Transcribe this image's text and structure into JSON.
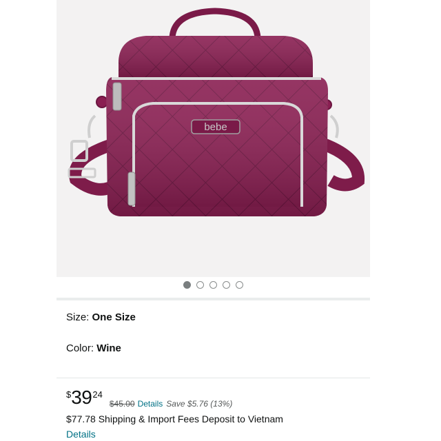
{
  "product": {
    "brand_mark": "bebe",
    "colors": {
      "bag": "#8a1f52",
      "bag_dark": "#6b1540",
      "trim": "#d9d9d9",
      "background": "#f3f2f2"
    }
  },
  "gallery": {
    "image_count": 5,
    "active_index": 0
  },
  "variants": {
    "size_label": "Size: ",
    "size_value": "One Size",
    "color_label": "Color: ",
    "color_value": "Wine"
  },
  "price": {
    "symbol": "$",
    "whole": "39",
    "fraction": "24",
    "list_price": "$45.00",
    "list_details": "Details",
    "savings": "Save $5.76 (13%)"
  },
  "shipping": {
    "text": "$77.78 Shipping & Import Fees Deposit to Vietnam",
    "details_link": "Details"
  }
}
